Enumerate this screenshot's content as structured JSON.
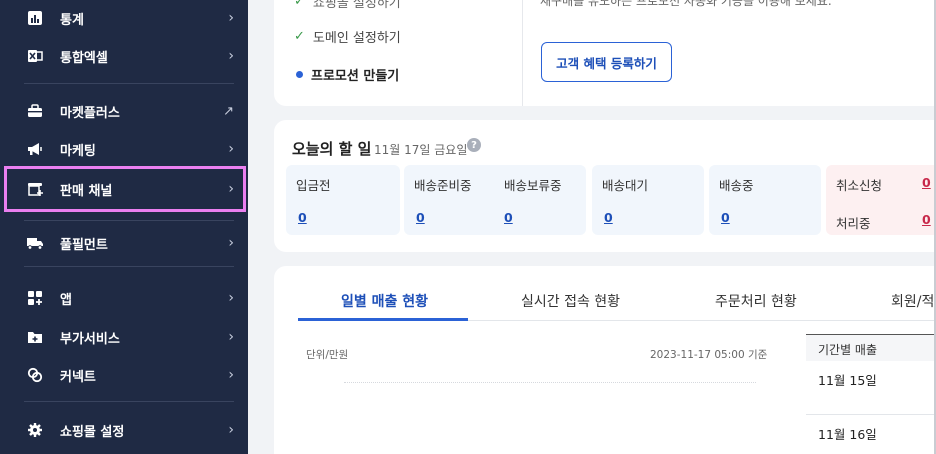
{
  "sidebar": {
    "items": [
      {
        "label": "통계",
        "icon": "bar-chart-icon"
      },
      {
        "label": "통합엑셀",
        "icon": "excel-icon"
      },
      {
        "label": "마켓플러스",
        "icon": "briefcase-icon",
        "external": "↗"
      },
      {
        "label": "마케팅",
        "icon": "megaphone-icon"
      },
      {
        "label": "판매 채널",
        "icon": "store-plus-icon",
        "active": true
      },
      {
        "label": "풀필먼트",
        "icon": "truck-icon"
      },
      {
        "label": "앱",
        "icon": "apps-grid-icon"
      },
      {
        "label": "부가서비스",
        "icon": "folder-plus-icon"
      },
      {
        "label": "커넥트",
        "icon": "link-icon"
      },
      {
        "label": "쇼핑몰 설정",
        "icon": "gear-icon"
      }
    ],
    "chevron": "›"
  },
  "setup": {
    "item_done_partial": "쇼핑몰 설정하기",
    "item_domain": "도메인 설정하기",
    "item_promotion": "프로모션 만들기",
    "right_text": "재구매를 유도하는 프로모션 자동화 기능을 이용해 보세요.",
    "benefit_button": "고객 혜택 등록하기"
  },
  "today": {
    "title": "오늘의 할 일",
    "date": "11월 17일 금요일",
    "help": "?",
    "statuses": [
      {
        "label": "입금전",
        "value": "0"
      },
      {
        "label": "배송준비중",
        "value": "0"
      },
      {
        "label": "배송보류중",
        "value": "0"
      },
      {
        "label": "배송대기",
        "value": "0"
      },
      {
        "label": "배송중",
        "value": "0"
      }
    ],
    "cancel": {
      "label": "취소신청",
      "value": "0",
      "sub_label": "처리중",
      "sub_value": "0"
    }
  },
  "tabs": [
    "일별 매출 현황",
    "실시간 접속 현황",
    "주문처리 현황",
    "회원/적"
  ],
  "sales": {
    "unit": "단위/만원",
    "timestamp": "2023-11-17 05:00 기준",
    "table_header": "기간별 매출",
    "rows": [
      "11월 15일",
      "11월 16일"
    ]
  },
  "colors": {
    "sidebar_bg": "#1f2a44",
    "accent": "#1d4fb8",
    "active_outline": "#ea7ff0",
    "cancel_bg": "#fdf0f1"
  }
}
